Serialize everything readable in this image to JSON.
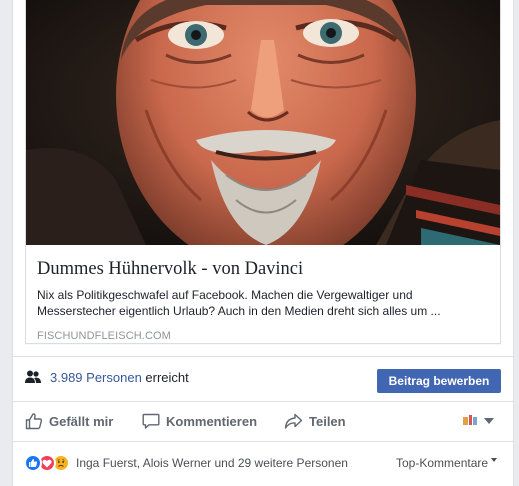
{
  "link_preview": {
    "image_icon": "portrait-artwork",
    "title": "Dummes Hühnervolk - von Davinci",
    "description": "Nix als Politikgeschwafel auf Facebook. Machen die Vergewaltiger und Messerstecher eigentlich Urlaub? Auch in den Medien dreht sich alles um ...",
    "domain": "FISCHUNDFLEISCH.COM"
  },
  "reach": {
    "icon": "people-icon",
    "count_text": "3.989 Personen",
    "suffix_text": "erreicht",
    "boost_label": "Beitrag bewerben",
    "boost_color": "#4267b2"
  },
  "actions": {
    "like_label": "Gefällt mir",
    "comment_label": "Kommentieren",
    "share_label": "Teilen",
    "like_icon": "thumbs-up-icon",
    "comment_icon": "speech-bubble-icon",
    "share_icon": "share-arrow-icon",
    "audience_icon": "page-avatar-icon",
    "audience_dropdown_icon": "chevron-down-icon"
  },
  "reactions": {
    "icons": [
      "like",
      "love",
      "sad"
    ],
    "colors": {
      "like": "#1877f2",
      "love": "#f33e58",
      "sad": "#f7b125"
    },
    "summary_text": "Inga Fuerst, Alois Werner und 29 weitere Personen",
    "sort_label": "Top-Kommentare"
  }
}
